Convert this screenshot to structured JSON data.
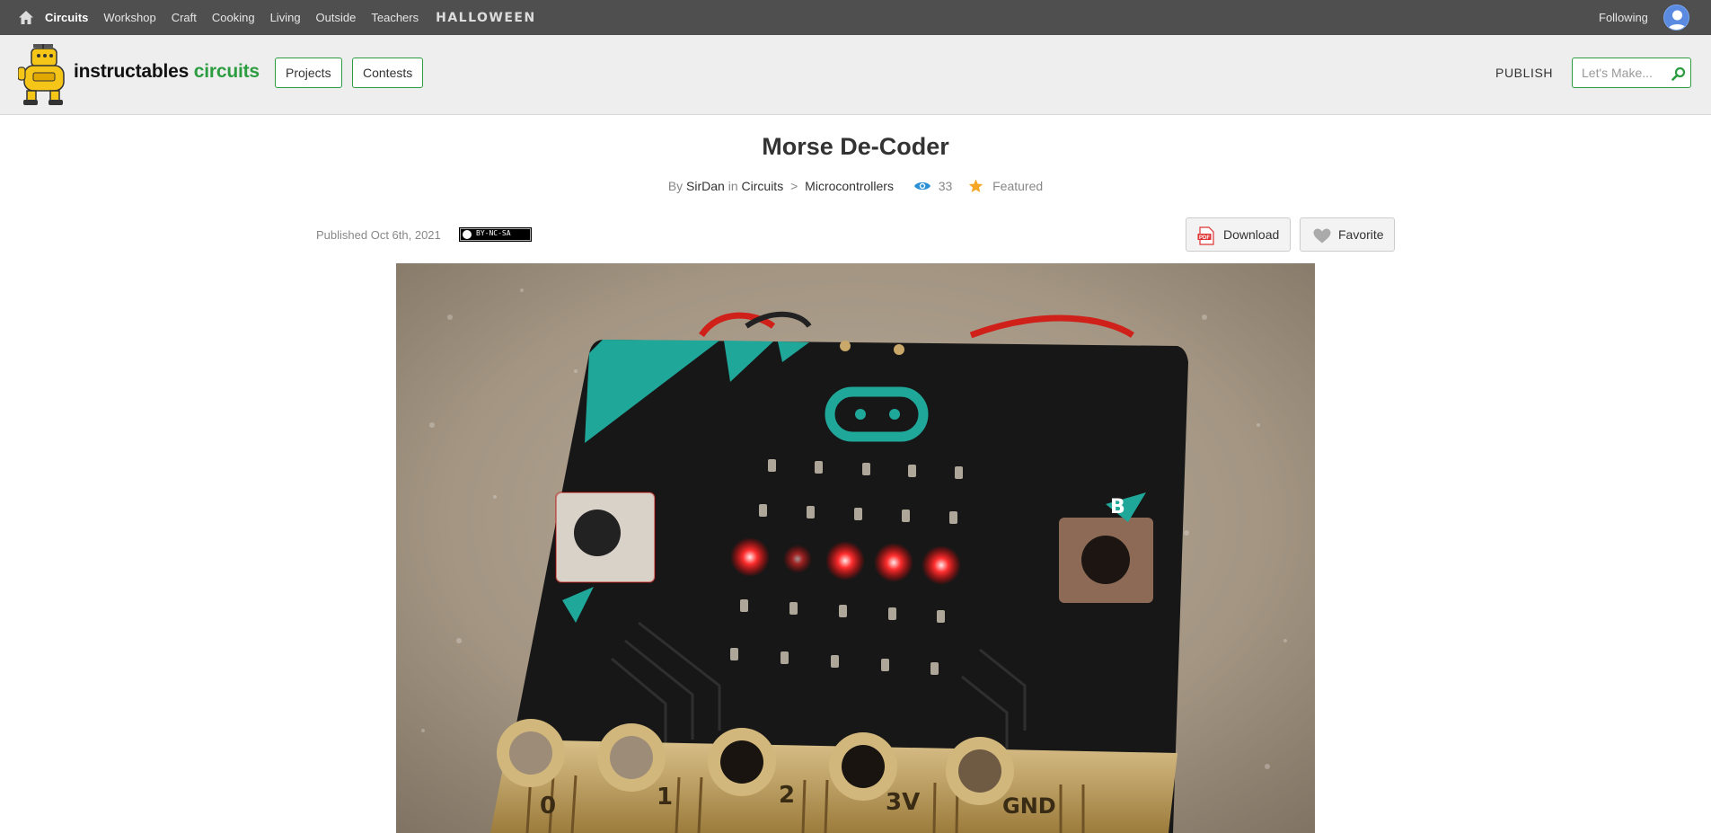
{
  "topnav": {
    "home_icon": "home-icon",
    "categories": [
      {
        "label": "Circuits",
        "active": true
      },
      {
        "label": "Workshop"
      },
      {
        "label": "Craft"
      },
      {
        "label": "Cooking"
      },
      {
        "label": "Living"
      },
      {
        "label": "Outside"
      },
      {
        "label": "Teachers"
      },
      {
        "label": "HALLOWEEN"
      }
    ],
    "following_label": "Following",
    "avatar_icon": "user-avatar-icon"
  },
  "header": {
    "logo_prefix": "instructables",
    "logo_suffix": "circuits",
    "projects_label": "Projects",
    "contests_label": "Contests",
    "publish_label": "PUBLISH",
    "search_placeholder": "Let's Make...",
    "brand_color": "#2c9c41"
  },
  "article": {
    "title": "Morse De-Coder",
    "by_label": "By",
    "author": "SirDan",
    "in_label": "in",
    "category": "Circuits",
    "breadcrumb_sep": ">",
    "subcategory": "Microcontrollers",
    "views": "33",
    "featured_label": "Featured",
    "published": "Published Oct 6th, 2021",
    "license": "BY-NC-SA",
    "download_label": "Download",
    "favorite_label": "Favorite"
  }
}
